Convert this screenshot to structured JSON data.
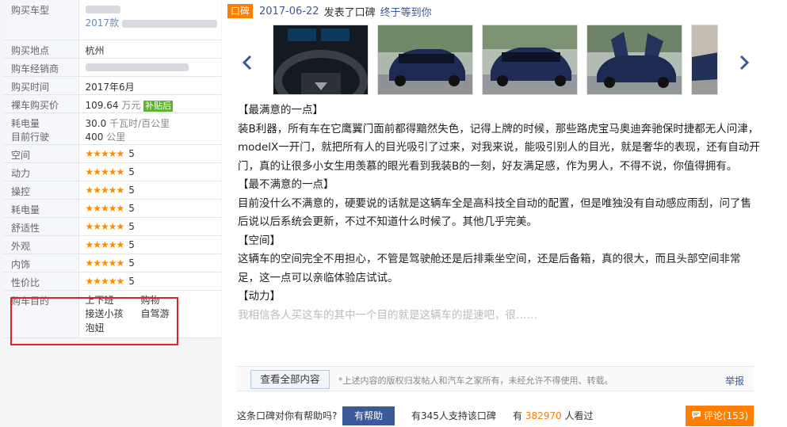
{
  "specs": {
    "buy_model_label": "购买车型",
    "buy_model_value_line2": "2017款",
    "buy_location_label": "购买地点",
    "buy_location_value": "杭州",
    "dealer_label": "购车经销商",
    "buy_time_label": "购买时间",
    "buy_time_value": "2017年6月",
    "price_label": "裸车购买价",
    "price_value": "109.64",
    "price_unit": "万元",
    "price_tag": "补贴后",
    "power_label": "耗电量",
    "power_value": "30.0",
    "power_unit": "千瓦时/百公里",
    "mileage_label": "目前行驶",
    "mileage_value": "400",
    "mileage_unit": "公里",
    "ratings": [
      {
        "label": "空间",
        "stars": "★★★★★",
        "score": "5"
      },
      {
        "label": "动力",
        "stars": "★★★★★",
        "score": "5"
      },
      {
        "label": "操控",
        "stars": "★★★★★",
        "score": "5"
      },
      {
        "label": "耗电量",
        "stars": "★★★★★",
        "score": "5"
      },
      {
        "label": "舒适性",
        "stars": "★★★★★",
        "score": "5"
      },
      {
        "label": "外观",
        "stars": "★★★★★",
        "score": "5"
      },
      {
        "label": "内饰",
        "stars": "★★★★★",
        "score": "5"
      },
      {
        "label": "性价比",
        "stars": "★★★★★",
        "score": "5"
      }
    ],
    "purpose_label": "购车目的",
    "purposes": [
      "上下班",
      "购物",
      "接送小孩",
      "自驾游",
      "泡妞"
    ]
  },
  "review": {
    "badge": "口碑",
    "date": "2017-06-22",
    "posted": "发表了口碑",
    "title": "终于等到你",
    "photo_icons": [
      "steering-wheel-photo",
      "car-front-photo",
      "car-front-photo",
      "falcon-door-photo",
      "car-side-photo"
    ],
    "s1_head": "【最满意的一点】",
    "s1_body": "装B利器，所有车在它鹰翼门面前都得黯然失色，记得上牌的时候，那些路虎宝马奥迪奔驰保时捷都无人问津，modelX一开门，就把所有人的目光吸引了过来，对我来说，能吸引别人的目光，就是奢华的表现，还有自动开门，真的让很多小女生用羡慕的眼光看到我装B的一刻，好友满足感，作为男人，不得不说，你值得拥有。",
    "s2_head": "【最不满意的一点】",
    "s2_body": "目前没什么不满意的，硬要说的话就是这辆车全是高科技全自动的配置，但是唯独没有自动感应雨刮，问了售后说以后系统会更新，不过不知道什么时候了。其他几乎完美。",
    "s3_head": "【空间】",
    "s3_body": "这辆车的空间完全不用担心，不管是驾驶舱还是后排乘坐空间，还是后备箱，真的很大，而且头部空间非常足，这一点可以亲临体验店试试。",
    "s4_head": "【动力】",
    "s4_body": "我相信各人买这车的其中一个目的就是这辆车的提速吧，很……"
  },
  "actions": {
    "view_all": "查看全部内容",
    "copyright": "*上述内容的版权归发帖人和汽车之家所有，未经允许不得使用、转载。",
    "report": "举报",
    "helpful_q": "这条口碑对你有帮助吗?",
    "helpful_btn": "有帮助",
    "support_pre": "有",
    "support_num": "345",
    "support_post": "人支持该口碑",
    "views_pre": "有",
    "views_num": "382970",
    "views_post": "人看过",
    "comment": "评论(153)"
  },
  "colors": {
    "accent": "#ff7e00",
    "link": "#3b5998",
    "tag": "#5cb32e",
    "highlight_box": "#d9252b"
  }
}
